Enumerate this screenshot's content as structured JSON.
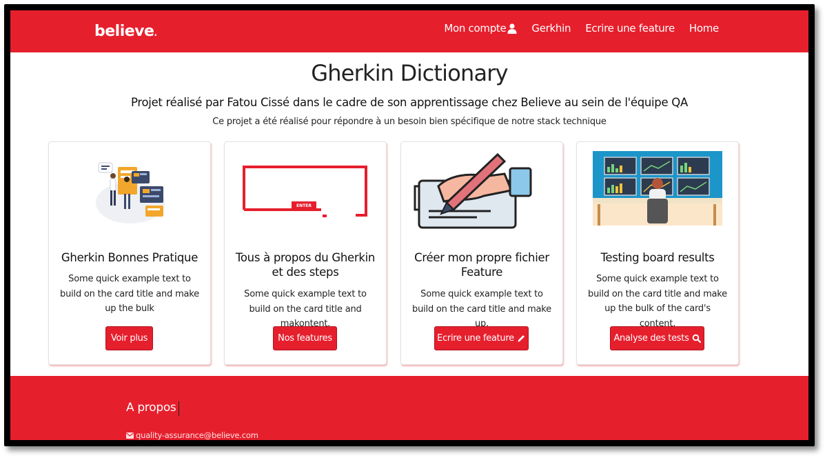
{
  "navbar": {
    "brand": "believe",
    "brand_dot": ".",
    "links": [
      {
        "label": "Mon compte",
        "icon": "user-icon"
      },
      {
        "label": "Gerkhin"
      },
      {
        "label": "Ecrire une feature"
      },
      {
        "label": "Home"
      }
    ]
  },
  "header": {
    "title": "Gherkin Dictionary",
    "subtitle": "Projet réalisé par Fatou Cissé dans le cadre de son apprentissage chez Believe au sein de l'équipe QA",
    "lead": "Ce projet a été réalisé pour répondre à un besoin bien spécifique de notre stack technique"
  },
  "cards": [
    {
      "title": "Gherkin Bonnes Pratique",
      "text": "Some quick example text to build on the card title and make up the bulk",
      "button": "Voir plus",
      "illustration": "team-dashboard-illustration"
    },
    {
      "title": "Tous à propos du Gherkin et des steps",
      "text": "Some quick example text to build on the card title and makontent.",
      "button": "Nos features",
      "illustration": "enter-key-illustration",
      "enter_label": "ENTER"
    },
    {
      "title": "Créer mon propre fichier Feature",
      "text": "Some quick example text to build on the card title and make up.",
      "button": "Ecrire une feature",
      "button_icon": "pencil-icon",
      "illustration": "hand-writing-illustration"
    },
    {
      "title": "Testing board results",
      "text": "Some quick example text to build on the card title and make up the bulk of the card's content.",
      "button": "Analyse des tests",
      "button_icon": "search-icon",
      "illustration": "monitoring-screens-illustration"
    }
  ],
  "footer": {
    "heading": "A propos",
    "email": "quality-assurance@believe.com",
    "email_icon": "envelope-icon"
  },
  "colors": {
    "brand_red": "#e61f2d",
    "text_dark": "#222222"
  }
}
